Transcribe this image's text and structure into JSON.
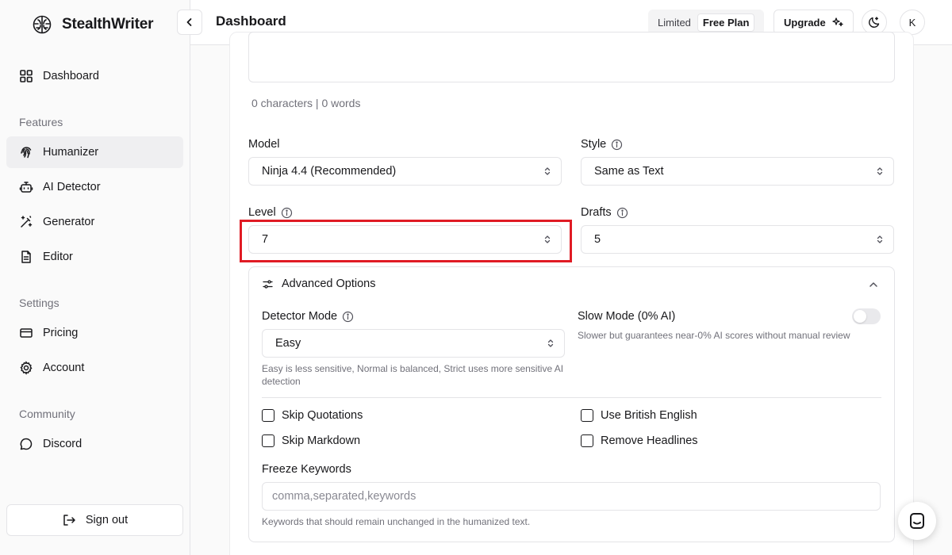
{
  "app": {
    "name": "StealthWriter"
  },
  "sidebar": {
    "dashboard_label": "Dashboard",
    "sections": {
      "features": "Features",
      "settings": "Settings",
      "community": "Community"
    },
    "features_items": [
      {
        "label": "Humanizer",
        "icon": "fingerprint-icon",
        "active": true
      },
      {
        "label": "AI Detector",
        "icon": "bot-icon"
      },
      {
        "label": "Generator",
        "icon": "magic-wand-icon"
      },
      {
        "label": "Editor",
        "icon": "document-icon"
      }
    ],
    "settings_items": [
      {
        "label": "Pricing",
        "icon": "credit-card-icon"
      },
      {
        "label": "Account",
        "icon": "gear-icon"
      }
    ],
    "community_items": [
      {
        "label": "Discord",
        "icon": "chat-bubble-icon"
      }
    ],
    "signout_label": "Sign out"
  },
  "header": {
    "title": "Dashboard",
    "plan_prefix": "Limited",
    "plan_name": "Free Plan",
    "upgrade_label": "Upgrade",
    "avatar_initial": "K"
  },
  "editor": {
    "count_text": "0 characters | 0 words"
  },
  "options": {
    "model": {
      "label": "Model",
      "value": "Ninja 4.4 (Recommended)"
    },
    "style": {
      "label": "Style",
      "value": "Same as Text"
    },
    "level": {
      "label": "Level",
      "value": "7"
    },
    "drafts": {
      "label": "Drafts",
      "value": "5"
    }
  },
  "advanced": {
    "title": "Advanced Options",
    "detector_mode": {
      "label": "Detector Mode",
      "value": "Easy",
      "helper": "Easy is less sensitive, Normal is balanced, Strict uses more sensitive AI detection"
    },
    "slow_mode": {
      "label": "Slow Mode (0% AI)",
      "helper": "Slower but guarantees near-0% AI scores without manual review",
      "enabled": false
    },
    "checkboxes": {
      "skip_quotations": "Skip Quotations",
      "skip_markdown": "Skip Markdown",
      "british_english": "Use British English",
      "remove_headlines": "Remove Headlines"
    },
    "freeze_keywords": {
      "label": "Freeze Keywords",
      "placeholder": "comma,separated,keywords",
      "helper": "Keywords that should remain unchanged in the humanized text."
    }
  },
  "colors": {
    "highlight": "#e01b24",
    "active_nav": "#efeff1",
    "border": "#e4e4e7",
    "muted_text": "#71717a"
  }
}
